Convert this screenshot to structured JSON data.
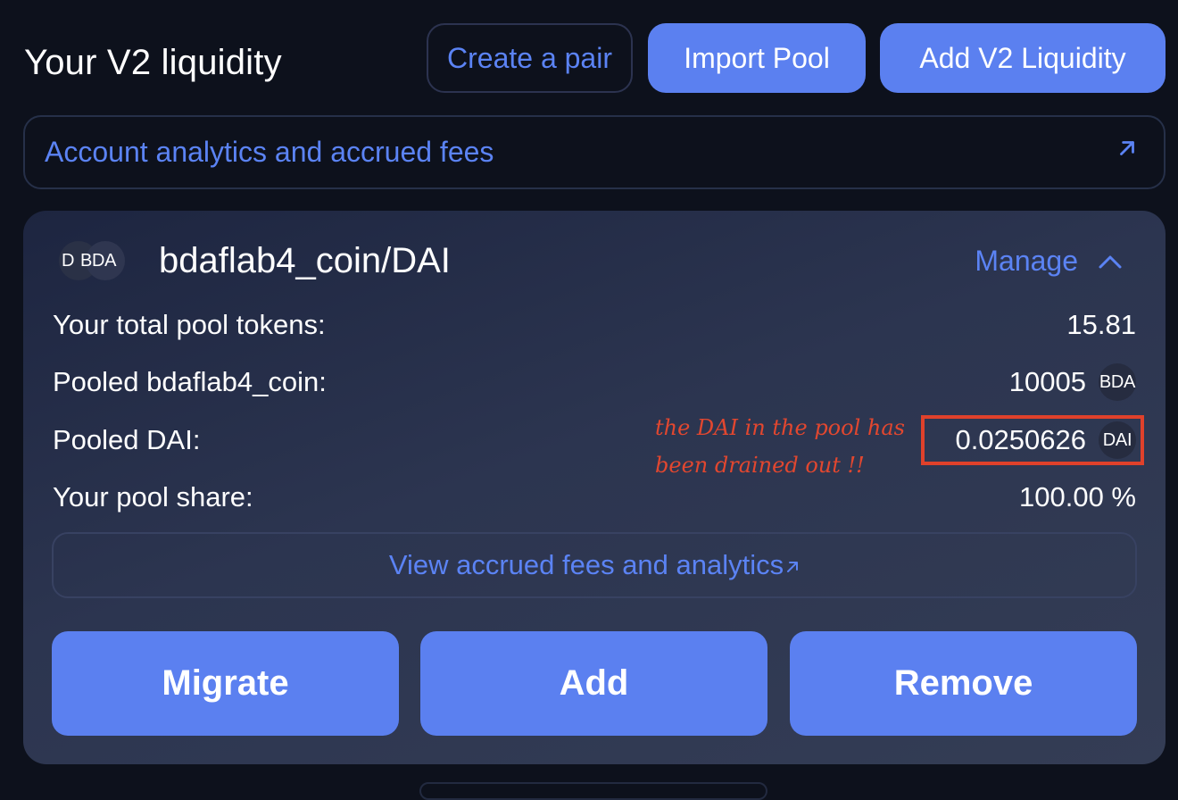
{
  "header": {
    "title": "Your V2 liquidity",
    "create_pair_label": "Create a pair",
    "import_pool_label": "Import Pool",
    "add_v2_liquidity_label": "Add V2 Liquidity"
  },
  "analytics_link": {
    "label": "Account analytics and accrued fees",
    "icon": "arrow-up-right-icon"
  },
  "position": {
    "logo_left": "D",
    "logo_right": "BDA",
    "pair_name": "bdaflab4_coin/DAI",
    "manage_label": "Manage",
    "manage_icon": "chevron-up-icon",
    "rows": [
      {
        "label": "Your total pool tokens:",
        "value": "15.81"
      },
      {
        "label": "Pooled bdaflab4_coin:",
        "value": "10005",
        "token": "BDA"
      },
      {
        "label": "Pooled DAI:",
        "value": "0.0250626",
        "token": "DAI"
      },
      {
        "label": "Your pool share:",
        "value": "100.00 %"
      }
    ],
    "view_fees_label": "View accrued fees and analytics",
    "view_fees_icon": "arrow-up-right-icon",
    "actions": {
      "migrate": "Migrate",
      "add": "Add",
      "remove": "Remove"
    }
  },
  "annotation": {
    "line1": "the DAI in the pool has",
    "line2": "been drained out !!",
    "color": "#e2472f"
  },
  "colors": {
    "background": "#0d111c",
    "accent": "#5b80f0",
    "link": "#5b83f4",
    "highlight": "#e0412b"
  }
}
